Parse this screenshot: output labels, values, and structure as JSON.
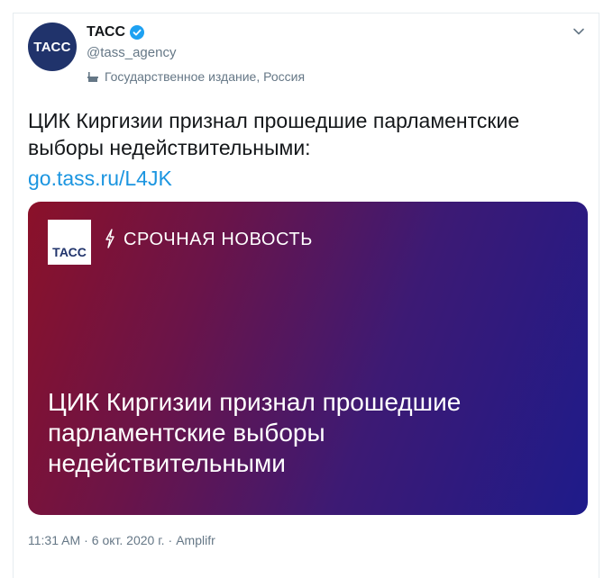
{
  "account": {
    "avatar_text": "ТАСС",
    "display_name": "ТАСС",
    "handle": "@tass_agency",
    "label": "Государственное издание, Россия",
    "verified_icon": "verified-badge-icon",
    "label_icon": "government-building-icon"
  },
  "tweet": {
    "text": "ЦИК Киргизии признал прошедшие парламентские выборы недействительными:",
    "link": "go.tass.ru/L4JK"
  },
  "media_card": {
    "logo_text": "ТАСС",
    "urgent_label": "СРОЧНАЯ НОВОСТЬ",
    "headline": "ЦИК Киргизии признал прошедшие парламентские выборы недействительными"
  },
  "meta": {
    "time": "11:31 AM",
    "separator1": "·",
    "date": "6 окт. 2020 г.",
    "separator2": "·",
    "source": "Amplifr"
  },
  "colors": {
    "link": "#1b95e0",
    "verified": "#1da1f2",
    "secondary_text": "#657786",
    "brand": "#20336b"
  }
}
